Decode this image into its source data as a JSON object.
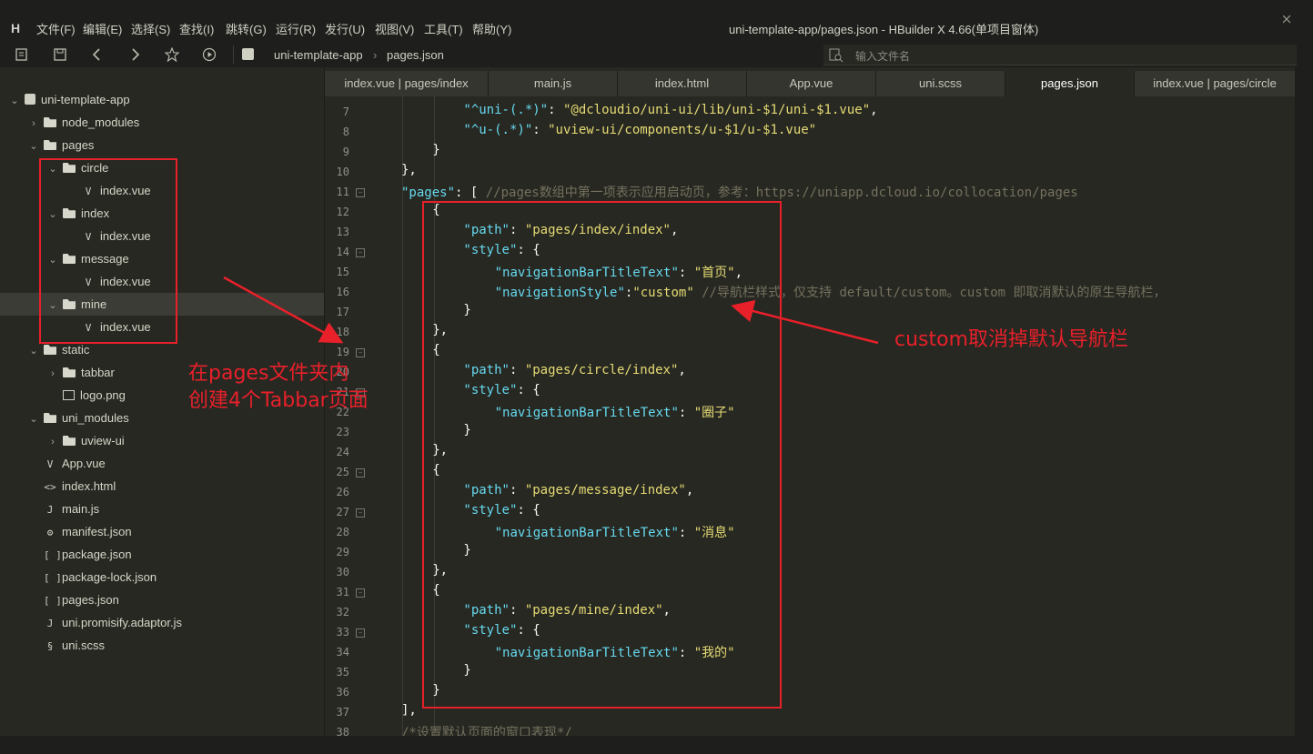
{
  "menubar": {
    "logo": "H",
    "items": [
      "文件(F)",
      "编辑(E)",
      "选择(S)",
      "查找(I)",
      "跳转(G)",
      "运行(R)",
      "发行(U)",
      "视图(V)",
      "工具(T)",
      "帮助(Y)"
    ],
    "title": "uni-template-app/pages.json - HBuilder X 4.66(单项目窗体)"
  },
  "toolbar": {
    "breadcrumb": [
      "uni-template-app",
      "pages.json"
    ],
    "search_placeholder": "输入文件名",
    "icons": [
      "new-file-icon",
      "save-icon",
      "back-icon",
      "forward-icon",
      "star-icon",
      "run-icon"
    ]
  },
  "sidebar": {
    "items": [
      {
        "label": "uni-template-app",
        "icon": "project-icon"
      },
      {
        "label": "node_modules",
        "icon": "folder-icon"
      },
      {
        "label": "pages",
        "icon": "folder-icon"
      },
      {
        "label": "circle",
        "icon": "folder-icon"
      },
      {
        "label": "index.vue",
        "icon": "vue-file-icon"
      },
      {
        "label": "index",
        "icon": "folder-icon"
      },
      {
        "label": "index.vue",
        "icon": "vue-file-icon"
      },
      {
        "label": "message",
        "icon": "folder-icon"
      },
      {
        "label": "index.vue",
        "icon": "vue-file-icon"
      },
      {
        "label": "mine",
        "icon": "folder-icon"
      },
      {
        "label": "index.vue",
        "icon": "vue-file-icon"
      },
      {
        "label": "static",
        "icon": "folder-icon"
      },
      {
        "label": "tabbar",
        "icon": "folder-icon"
      },
      {
        "label": "logo.png",
        "icon": "image-icon"
      },
      {
        "label": "uni_modules",
        "icon": "folder-icon"
      },
      {
        "label": "uview-ui",
        "icon": "folder-icon"
      },
      {
        "label": "App.vue",
        "icon": "vue-file-icon"
      },
      {
        "label": "index.html",
        "icon": "html-file-icon"
      },
      {
        "label": "main.js",
        "icon": "js-file-icon"
      },
      {
        "label": "manifest.json",
        "icon": "manifest-icon"
      },
      {
        "label": "package.json",
        "icon": "json-file-icon"
      },
      {
        "label": "package-lock.json",
        "icon": "json-file-icon"
      },
      {
        "label": "pages.json",
        "icon": "json-file-icon"
      },
      {
        "label": "uni.promisify.adaptor.js",
        "icon": "js-file-icon"
      },
      {
        "label": "uni.scss",
        "icon": "scss-file-icon"
      }
    ]
  },
  "tabs": [
    {
      "label": "index.vue | pages/index"
    },
    {
      "label": "main.js"
    },
    {
      "label": "index.html"
    },
    {
      "label": "App.vue"
    },
    {
      "label": "uni.scss"
    },
    {
      "label": "pages.json",
      "active": true
    },
    {
      "label": "index.vue | pages/circle"
    }
  ],
  "editor": {
    "line_numbers": [
      "7",
      "8",
      "9",
      "10",
      "11",
      "12",
      "13",
      "14",
      "15",
      "16",
      "17",
      "18",
      "19",
      "20",
      "21",
      "22",
      "23",
      "24",
      "25",
      "26",
      "27",
      "28",
      "29",
      "30",
      "31",
      "32",
      "33",
      "34",
      "35",
      "36",
      "37",
      "38"
    ],
    "lines": [
      [
        "\"^uni-(.*)\"",
        ": ",
        "\"@dcloudio/uni-ui/lib/uni-$1/uni-$1.vue\"",
        ","
      ],
      [
        "\"^u-(.*)\"",
        ": ",
        "\"uview-ui/components/u-$1/u-$1.vue\""
      ],
      [
        "}"
      ],
      [
        "},"
      ],
      [
        "\"pages\"",
        ": [ ",
        "//pages数组中第一项表示应用启动页，参考：https://uniapp.dcloud.io/collocation/pages"
      ],
      [
        "{"
      ],
      [
        "\"path\"",
        ": ",
        "\"pages/index/index\"",
        ","
      ],
      [
        "\"style\"",
        ": {"
      ],
      [
        "\"navigationBarTitleText\"",
        ": ",
        "\"首页\"",
        ","
      ],
      [
        "\"navigationStyle\"",
        ":",
        "\"custom\"",
        " ",
        "//导航栏样式，仅支持 default/custom。custom 即取消默认的原生导航栏，"
      ],
      [
        "}"
      ],
      [
        "},"
      ],
      [
        "{"
      ],
      [
        "\"path\"",
        ": ",
        "\"pages/circle/index\"",
        ","
      ],
      [
        "\"style\"",
        ": {"
      ],
      [
        "\"navigationBarTitleText\"",
        ": ",
        "\"圈子\""
      ],
      [
        "}"
      ],
      [
        "},"
      ],
      [
        "{"
      ],
      [
        "\"path\"",
        ": ",
        "\"pages/message/index\"",
        ","
      ],
      [
        "\"style\"",
        ": {"
      ],
      [
        "\"navigationBarTitleText\"",
        ": ",
        "\"消息\""
      ],
      [
        "}"
      ],
      [
        "},"
      ],
      [
        "{"
      ],
      [
        "\"path\"",
        ": ",
        "\"pages/mine/index\"",
        ","
      ],
      [
        "\"style\"",
        ": {"
      ],
      [
        "\"navigationBarTitleText\"",
        ": ",
        "\"我的\""
      ],
      [
        "}"
      ],
      [
        "}"
      ],
      [
        "],"
      ],
      [
        "/*设置默认页面的窗口表现*/"
      ]
    ]
  },
  "annotations": {
    "left_note": [
      "在pages文件夹内",
      "创建4个Tabbar页面"
    ],
    "right_note": "custom取消掉默认导航栏",
    "color": "#e8202a"
  }
}
